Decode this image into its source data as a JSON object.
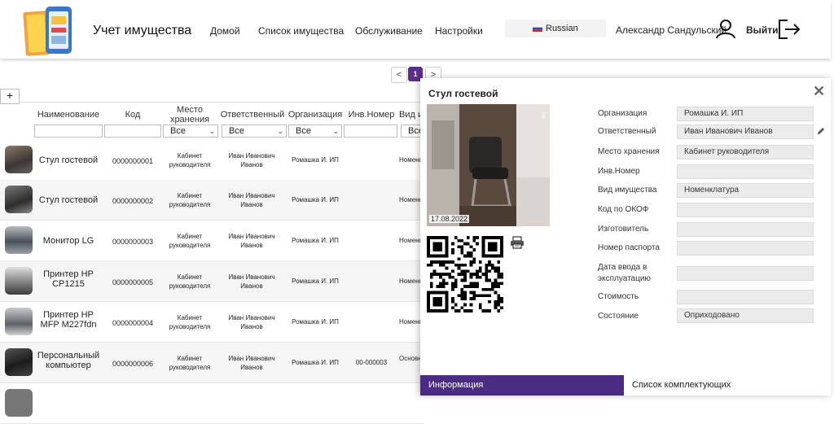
{
  "header": {
    "title": "Учет имущества",
    "nav": [
      "Домой",
      "Список имущества",
      "Обслуживание",
      "Настройки"
    ],
    "language": "Russian",
    "user_name": "Александр Сандульский",
    "logout": "Выйти"
  },
  "pager": {
    "prev": "<",
    "current": "1",
    "next": ">"
  },
  "table": {
    "add_label": "+",
    "columns": [
      "Наименование",
      "Код",
      "Место хранения",
      "Ответственный",
      "Организация",
      "Инв.Номер",
      "Вид имущества"
    ],
    "filter_value": "Все",
    "rows": [
      {
        "name": "Стул гостевой",
        "code": "0000000001",
        "location": "Кабинет руководителя",
        "responsible": "Иван Иванович Иванов",
        "org": "Ромашка И. ИП",
        "inv": "",
        "type": "Номенклатура"
      },
      {
        "name": "Стул гостевой",
        "code": "0000000002",
        "location": "Кабинет руководителя",
        "responsible": "Иван Иванович Иванов",
        "org": "Ромашка И. ИП",
        "inv": "",
        "type": "Номенклатура"
      },
      {
        "name": "Монитор LG",
        "code": "0000000003",
        "location": "Кабинет руководителя",
        "responsible": "Иван Иванович Иванов",
        "org": "Ромашка И. ИП",
        "inv": "",
        "type": "Номенклатура"
      },
      {
        "name": "Принтер HP CP1215",
        "code": "0000000005",
        "location": "Кабинет руководителя",
        "responsible": "Иван Иванович Иванов",
        "org": "Ромашка И. ИП",
        "inv": "",
        "type": "Номенклатура"
      },
      {
        "name": "Принтер HP MFP M227fdn",
        "code": "0000000004",
        "location": "Кабинет руководителя",
        "responsible": "Иван Иванович Иванов",
        "org": "Ромашка И. ИП",
        "inv": "",
        "type": "Номенклатура"
      },
      {
        "name": "Персональный компьютер",
        "code": "0000000006",
        "location": "Кабинет руководителя",
        "responsible": "Иван Иванович Иванов",
        "org": "Ромашка И. ИП",
        "inv": "00-000003",
        "type": "Основные средства"
      }
    ]
  },
  "detail": {
    "title": "Стул гостевой",
    "close": "✕",
    "photo_date": "17.08.2022",
    "fields": [
      {
        "label": "Организация",
        "value": "Ромашка И. ИП"
      },
      {
        "label": "Ответственный",
        "value": "Иван Иванович Иванов"
      },
      {
        "label": "Место хранения",
        "value": "Кабинет руководителя"
      },
      {
        "label": "Инв.Номер",
        "value": ""
      },
      {
        "label": "Вид имущества",
        "value": "Номенклатура"
      },
      {
        "label": "Код по ОКОФ",
        "value": ""
      },
      {
        "label": "Изготовитель",
        "value": ""
      },
      {
        "label": "Номер паспорта",
        "value": ""
      },
      {
        "label": "Дата ввода в эксплуатацию",
        "value": ""
      },
      {
        "label": "Стоимость",
        "value": ""
      },
      {
        "label": "Состояние",
        "value": "Оприходовано"
      }
    ],
    "tabs": [
      "Информация",
      "Список комплектующих"
    ]
  },
  "colors": {
    "accent": "#5b2d8e",
    "tab_active": "#4a2c82"
  }
}
